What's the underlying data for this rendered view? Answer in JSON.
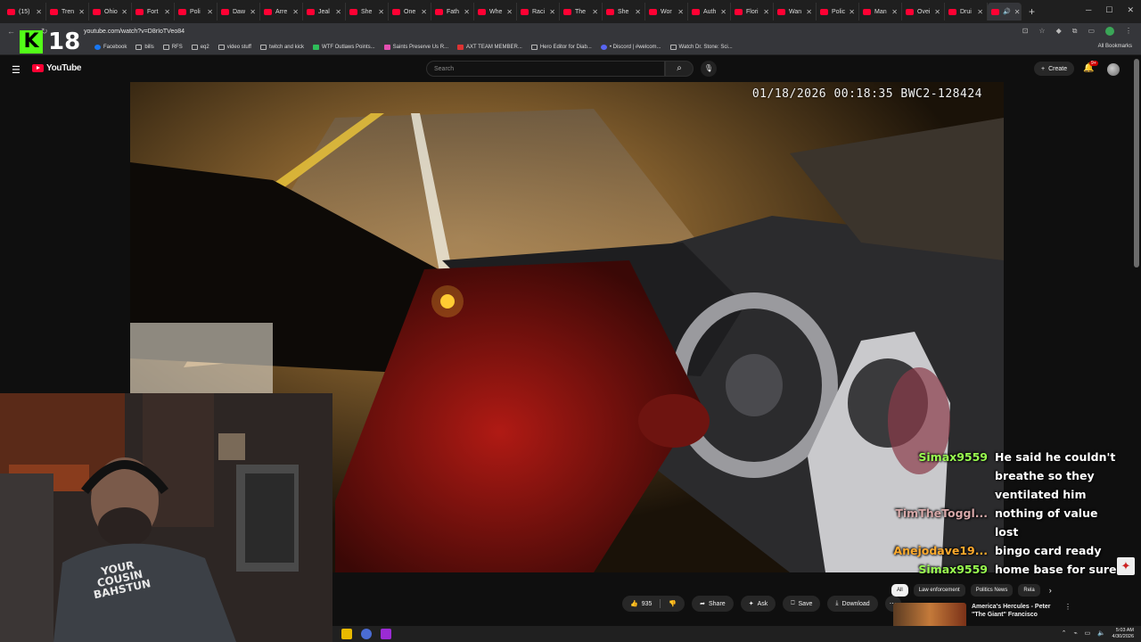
{
  "browser": {
    "tabs": [
      "(15)",
      "Tren",
      "Ohio",
      "Fort",
      "Poli",
      "Daw",
      "Arre",
      "Jeal",
      "She",
      "One",
      "Fath",
      "Whe",
      "Raci",
      "The",
      "She",
      "Wor",
      "Auth",
      "Flori",
      "Wan",
      "Polic",
      "Man",
      "Ovei",
      "Drui",
      ""
    ],
    "url": "youtube.com/watch?v=D8rIoTVeo84",
    "bookmarks": [
      "Facebook",
      "bills",
      "RFS",
      "eq2",
      "video stuff",
      "twitch and kick",
      "WTF Outlaws Points...",
      "Saints Preserve Us R...",
      "AXT TEAM MEMBER...",
      "Hero Editor for Diab...",
      "• Discord | #welcom...",
      "Watch Dr. Stone: Sci..."
    ],
    "all_bookmarks": "All Bookmarks"
  },
  "kick": {
    "viewer_count": "18"
  },
  "youtube": {
    "logo_text": "YouTube",
    "search_placeholder": "Search",
    "create_label": "Create",
    "notif_badge": "9+"
  },
  "video": {
    "timestamp": "01/18/2026 00:18:35 BWC2-128424"
  },
  "webcam": {
    "shirt_text": [
      "YOUR",
      "COUSIN",
      "BAHSTUN"
    ]
  },
  "chat": [
    {
      "user": "Simax9559",
      "user_color": "#9aff50",
      "message": "He said he couldn't breathe so they ventilated him"
    },
    {
      "user": "TimTheToggl...",
      "user_color": "#d7a8a8",
      "message": "nothing of value lost"
    },
    {
      "user": "Anejodave19...",
      "user_color": "#ffaa2c",
      "message": "bingo card ready"
    },
    {
      "user": "Simax9559",
      "user_color": "#9aff50",
      "message": "home base for sure"
    }
  ],
  "actions": {
    "like_count": "935",
    "share": "Share",
    "ask": "Ask",
    "save": "Save",
    "download": "Download"
  },
  "sidebar": {
    "chips": [
      "All",
      "Law enforcement",
      "Politics News",
      "Rela"
    ],
    "rec_title": "America's Hercules - Peter \"The Giant\" Francisco"
  },
  "taskbar": {
    "time": "5:03 AM",
    "date": "4/30/2026"
  }
}
